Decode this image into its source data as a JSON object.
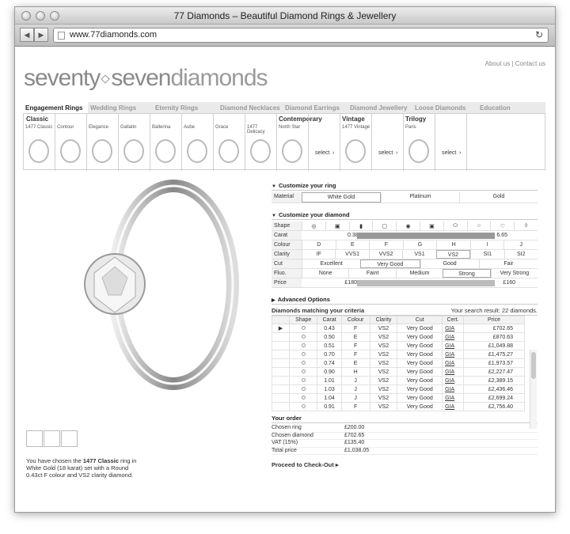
{
  "window": {
    "title": "77 Diamonds – Beautiful Diamond Rings & Jewellery",
    "url": "www.77diamonds.com"
  },
  "toplinks": {
    "about": "About us",
    "sep": " | ",
    "contact": "Contact us"
  },
  "logo": {
    "part1": "seventy",
    "part2": "seven",
    "part3": "diamonds"
  },
  "nav": [
    "Engagement Rings",
    "Wedding Rings",
    "Eternity Rings",
    "Diamond Necklaces",
    "Diamond Earrings",
    "Diamond Jewellery",
    "Loose Diamonds",
    "Education"
  ],
  "rings": {
    "classic_heading": "Classic",
    "classic": [
      "1477 Classic",
      "Contour",
      "Elegance",
      "Gallatin",
      "Ballerina",
      "Aube",
      "Grace",
      "1477 Delicacy"
    ],
    "groups": [
      {
        "heading": "Contemporary",
        "sub": "North Star",
        "select": "select"
      },
      {
        "heading": "Vintage",
        "sub": "1477 Vintage",
        "select": "select"
      },
      {
        "heading": "Trilogy",
        "sub": "Paris",
        "select": "select"
      }
    ]
  },
  "customize_ring": {
    "title": "Customize your ring",
    "material_label": "Material",
    "materials": [
      "White Gold",
      "Platinum",
      "Gold"
    ],
    "selected": "White Gold"
  },
  "customize_diamond": {
    "title": "Customize your diamond",
    "shape_label": "Shape",
    "carat": {
      "label": "Carat",
      "min": "0.38",
      "max": "6.65"
    },
    "colour": {
      "label": "Colour",
      "options": [
        "D",
        "E",
        "F",
        "G",
        "H",
        "I",
        "J"
      ]
    },
    "clarity": {
      "label": "Clarity",
      "options": [
        "IF",
        "VVS1",
        "VVS2",
        "VS1",
        "VS2",
        "SI1",
        "SI2"
      ]
    },
    "cut": {
      "label": "Cut",
      "options": [
        "Excellent",
        "Very Good",
        "Good",
        "Fair"
      ]
    },
    "fluo": {
      "label": "Fluo.",
      "options": [
        "None",
        "Faint",
        "Medium",
        "Strong",
        "Very Strong"
      ]
    },
    "price": {
      "label": "Price",
      "min": "£180",
      "max": "£160"
    }
  },
  "advanced": "Advanced Options",
  "matching": {
    "title": "Diamonds matching your criteria",
    "result": "Your search result: 22 diamonds."
  },
  "table": {
    "headers": [
      "Shape",
      "Carat",
      "Colour",
      "Clarity",
      "Cut",
      "Cert.",
      "Price"
    ],
    "rows": [
      [
        "0.43",
        "F",
        "VS2",
        "Very Good",
        "GIA",
        "£702.65"
      ],
      [
        "0.50",
        "E",
        "VS2",
        "Very Good",
        "GIA",
        "£870.63"
      ],
      [
        "0.51",
        "F",
        "VS2",
        "Very Good",
        "GIA",
        "£1,049.88"
      ],
      [
        "0.70",
        "F",
        "VS2",
        "Very Good",
        "GIA",
        "£1,475.27"
      ],
      [
        "0.74",
        "E",
        "VS2",
        "Very Good",
        "GIA",
        "£1,973.57"
      ],
      [
        "0.90",
        "H",
        "VS2",
        "Very Good",
        "GIA",
        "£2,227.47"
      ],
      [
        "1.01",
        "J",
        "VS2",
        "Very Good",
        "GIA",
        "£2,389.15"
      ],
      [
        "1.03",
        "J",
        "VS2",
        "Very Good",
        "GIA",
        "£2,436.46"
      ],
      [
        "1.04",
        "J",
        "VS2",
        "Very Good",
        "GIA",
        "£2,699.24"
      ],
      [
        "0.91",
        "F",
        "VS2",
        "Very Good",
        "GIA",
        "£2,756.40"
      ]
    ]
  },
  "order": {
    "title": "Your order",
    "lines": [
      [
        "Chosen ring",
        "£200.00"
      ],
      [
        "Chosen diamond",
        "£702.65"
      ],
      [
        "VAT (15%)",
        "£135.40"
      ],
      [
        "Total price",
        "£1,038.05"
      ]
    ],
    "checkout": "Proceed to Check-Out"
  },
  "choice_text": {
    "pre": "You have chosen the ",
    "ring": "1477 Classic",
    "post": " ring in White Gold (18 karat) set with a Round 0.43ct F colour and VS2 clarity diamond."
  }
}
